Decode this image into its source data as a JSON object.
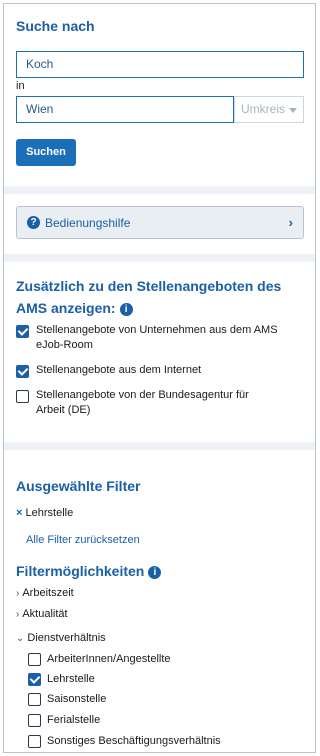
{
  "search": {
    "title": "Suche nach",
    "keyword_value": "Koch",
    "in_label": "in",
    "location_value": "Wien",
    "radius_placeholder": "Umkreis",
    "submit_label": "Suchen"
  },
  "help": {
    "label": "Bedienungshilfe"
  },
  "additional": {
    "title_line1": "Zusätzlich zu den Stellenangeboten des",
    "title_line2": "AMS anzeigen:",
    "options": [
      {
        "line1": "Stellenangebote von Unternehmen aus dem AMS",
        "line2": "eJob-Room",
        "checked": true
      },
      {
        "line1": "Stellenangebote aus dem Internet",
        "line2": "",
        "checked": true
      },
      {
        "line1": "Stellenangebote von der Bundesagentur für",
        "line2": "Arbeit (DE)",
        "checked": false
      }
    ]
  },
  "selected_filters": {
    "title": "Ausgewählte Filter",
    "items": [
      {
        "remove_symbol": "×",
        "label": "Lehrstelle"
      }
    ],
    "reset_label": "Alle Filter zurücksetzen"
  },
  "filter_options": {
    "title": "Filtermöglichkeiten",
    "groups": [
      {
        "label": "Arbeitszeit",
        "expanded": false
      },
      {
        "label": "Aktualität",
        "expanded": false
      },
      {
        "label": "Dienstverhältnis",
        "expanded": true
      }
    ],
    "dienstverhaeltnis_options": [
      {
        "label": "ArbeiterInnen/Angestellte",
        "checked": false
      },
      {
        "label": "Lehrstelle",
        "checked": true
      },
      {
        "label": "Saisonstelle",
        "checked": false
      },
      {
        "label": "Ferialstelle",
        "checked": false
      },
      {
        "label": "Sonstiges Beschäftigungsverhältnis",
        "checked": false
      }
    ]
  },
  "colors": {
    "accent": "#1b5fa6",
    "button": "#1b6fb8",
    "divider": "#eef1f5"
  }
}
